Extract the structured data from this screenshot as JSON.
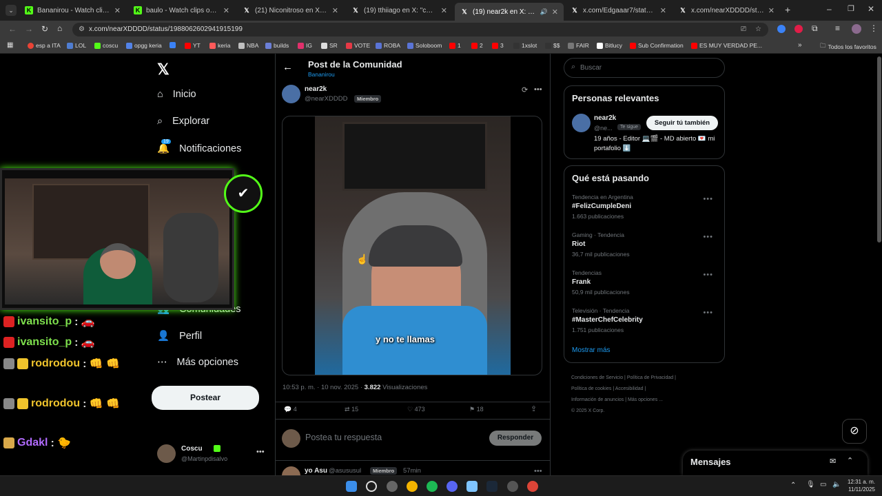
{
  "browser": {
    "tabs": [
      {
        "title": "Bananirou - Watch clips on Kick",
        "icon": "kick-icon"
      },
      {
        "title": "baulo - Watch clips on Kick",
        "icon": "kick-icon"
      },
      {
        "title": "(21) Niconitroso en X: \"bor que...",
        "icon": "x-icon"
      },
      {
        "title": "(19) tthiiago en X: \"cuando pre...",
        "icon": "x-icon"
      },
      {
        "title": "(19) near2k en X: \"https://t...",
        "icon": "x-icon"
      },
      {
        "title": "x.com/Edgaaar7/status/19866...",
        "icon": "x-icon"
      },
      {
        "title": "x.com/nearXDDDD/status/198...",
        "icon": "x-icon"
      }
    ],
    "url": "x.com/nearXDDDD/status/1988062602941915199",
    "bookmarks": [
      "esp a ITA",
      "LOL",
      "coscu",
      "opgg keria",
      "",
      "YT",
      "keria",
      "NBA",
      "builds",
      "IG",
      "SR",
      "VOTE",
      "ROBA",
      "Soloboom",
      "1",
      "2",
      "3",
      "1xslot",
      "$$",
      "FAIR",
      "Bitlucy",
      "Sub Confirmation",
      "ES MUY VERDAD PE..."
    ],
    "bookmarks_folder": "Todos los favoritos"
  },
  "nav": {
    "items": [
      "Inicio",
      "Explorar",
      "Notificaciones",
      "Comunidades",
      "Perfil",
      "Más opciones"
    ],
    "notif_count": "19",
    "post_button": "Postear",
    "account_name": "Coscu",
    "account_handle": "@Martinpdisalvo"
  },
  "post": {
    "header_title": "Post de la Comunidad",
    "header_sub": "Bananirou",
    "author_name": "near2k",
    "author_handle": "@nearXDDDD",
    "member_badge": "Miembro",
    "video_caption": "y no te llamas",
    "timestamp": "10:53 p. m. · 10 nov. 2025 · ",
    "views": "3.822",
    "views_label": "Visualizaciones",
    "replies": "4",
    "reposts": "15",
    "likes": "473",
    "bookmarks": "18",
    "reply_placeholder": "Postea tu respuesta",
    "reply_button": "Responder",
    "next_reply_name": "yo Asu",
    "next_reply_handle": "@asususul",
    "next_reply_time": "57min"
  },
  "sidebar": {
    "search_placeholder": "Buscar",
    "relevant_title": "Personas relevantes",
    "person_name": "near2k",
    "person_handle": "@ne...",
    "follows_you": "Te sigue",
    "follow_button": "Seguir tú también",
    "bio": "19 años - Editor 💻🎬 - MD abierto 💌 mi portafolio ⬇️",
    "trends_title": "Qué está pasando",
    "trends": [
      {
        "category": "Tendencia en Argentina",
        "name": "#FelizCumpleDeni",
        "count": "1.663 publicaciones"
      },
      {
        "category": "Gaming · Tendencia",
        "name": "Riot",
        "count": "36,7 mil publicaciones"
      },
      {
        "category": "Tendencias",
        "name": "Frank",
        "count": "50,9 mil publicaciones"
      },
      {
        "category": "Televisión · Tendencia",
        "name": "#MasterChefCelebrity",
        "count": "1.751 publicaciones"
      }
    ],
    "show_more": "Mostrar más",
    "footer": [
      "Condiciones de Servicio",
      "Política de Privacidad",
      "Política de cookies",
      "Accesibilidad",
      "Información de anuncios",
      "Más opciones ...",
      "© 2025 X Corp."
    ],
    "messages_title": "Mensajes"
  },
  "chat": [
    {
      "user": "ivansito_p",
      "color": "#7ee04d",
      "message": ": 🚗"
    },
    {
      "user": "ivansito_p",
      "color": "#7ee04d",
      "message": ": 🚗"
    },
    {
      "user": "rodrodou",
      "color": "#f0c42c",
      "message": ": 👊 👊"
    },
    {
      "user": "rodrodou",
      "color": "#f0c42c",
      "message": ": 👊 👊"
    },
    {
      "user": "Gdakl",
      "color": "#b26bff",
      "message": ": 🐤"
    }
  ],
  "taskbar": {
    "time": "12:31 a. m.",
    "date": "11/11/2025"
  },
  "colors": {
    "accent": "#1d9bf0",
    "kick": "#53fc18",
    "bg": "#000000"
  }
}
